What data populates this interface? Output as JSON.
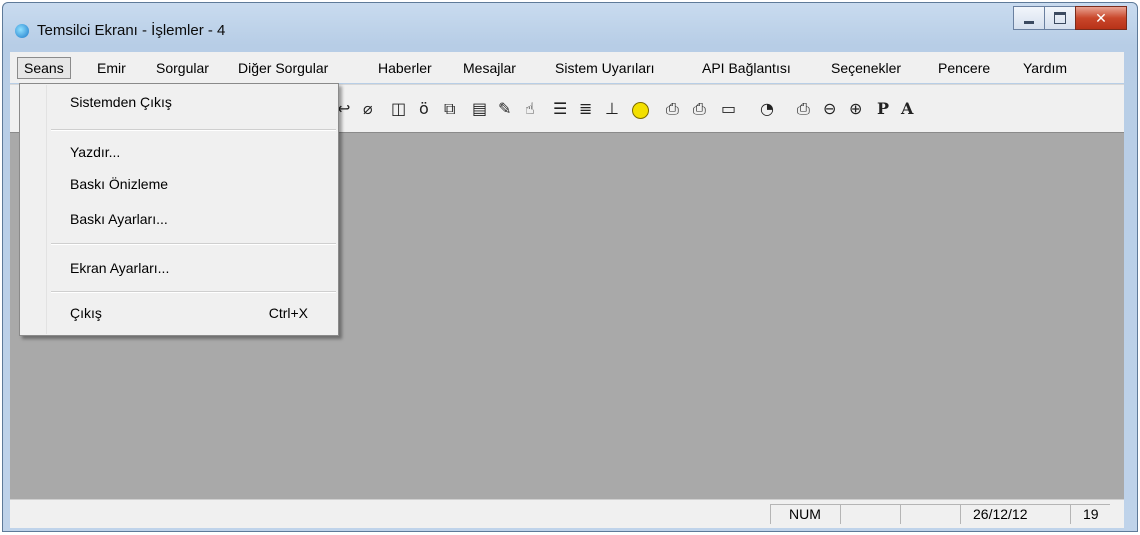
{
  "window": {
    "title": "Temsilci Ekranı - İşlemler - 4"
  },
  "menubar": [
    {
      "label": "Seans"
    },
    {
      "label": "Emir"
    },
    {
      "label": "Sorgular"
    },
    {
      "label": "Diğer Sorgular"
    },
    {
      "label": "Haberler"
    },
    {
      "label": "Mesajlar"
    },
    {
      "label": "Sistem Uyarıları"
    },
    {
      "label": "API Bağlantısı"
    },
    {
      "label": "Seçenekler"
    },
    {
      "label": "Pencere"
    },
    {
      "label": "Yardım"
    }
  ],
  "toolbar": {
    "icons": [
      "undo-icon",
      "eraser-icon",
      "columns-icon",
      "bottle-icon",
      "copy-icon",
      "document-icon",
      "edit-icon",
      "hand-icon",
      "align-icon",
      "list-icon",
      "chart-icon",
      "smiley-icon",
      "folder-down-icon",
      "folder-up-icon",
      "folder-icon",
      "clock-icon",
      "printer-icon",
      "zoom-out-icon",
      "zoom-in-icon",
      "p-icon",
      "a-icon"
    ]
  },
  "seans_menu": {
    "items": [
      {
        "label": "Sistemden Çıkış",
        "shortcut": ""
      },
      {
        "label": "Yazdır...",
        "shortcut": ""
      },
      {
        "label": "Baskı Önizleme",
        "shortcut": ""
      },
      {
        "label": "Baskı Ayarları...",
        "shortcut": ""
      },
      {
        "label": "Ekran Ayarları...",
        "shortcut": ""
      },
      {
        "label": "Çıkış",
        "shortcut": "Ctrl+X"
      }
    ]
  },
  "statusbar": {
    "num": "NUM",
    "date": "26/12/12",
    "time": "19"
  },
  "colors": {
    "workspace": "#a9a9a9",
    "menu": "#f0f0f0",
    "close": "#c9472b",
    "smiley": "#f3e000"
  }
}
